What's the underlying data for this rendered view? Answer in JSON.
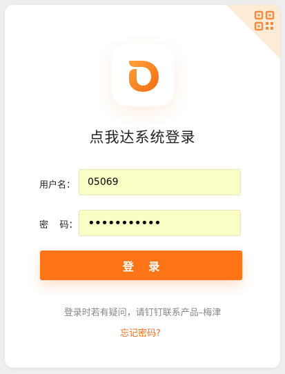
{
  "brand": {
    "title": "点我达系统登录"
  },
  "form": {
    "username_label": "用户名：",
    "username_value": "05069",
    "password_label": "密    码：",
    "password_value": "•••••••••••"
  },
  "actions": {
    "login_label": "登 录"
  },
  "footer": {
    "hint": "登录时若有疑问，请钉钉联系产品–梅津",
    "forgot_link": "忘记密码?"
  },
  "colors": {
    "accent": "#ff7417",
    "field_bg": "#fbfec4",
    "corner": "#fdebd6"
  },
  "icons": {
    "corner": "qr-code-icon",
    "logo": "dianwoda-logo-icon"
  }
}
